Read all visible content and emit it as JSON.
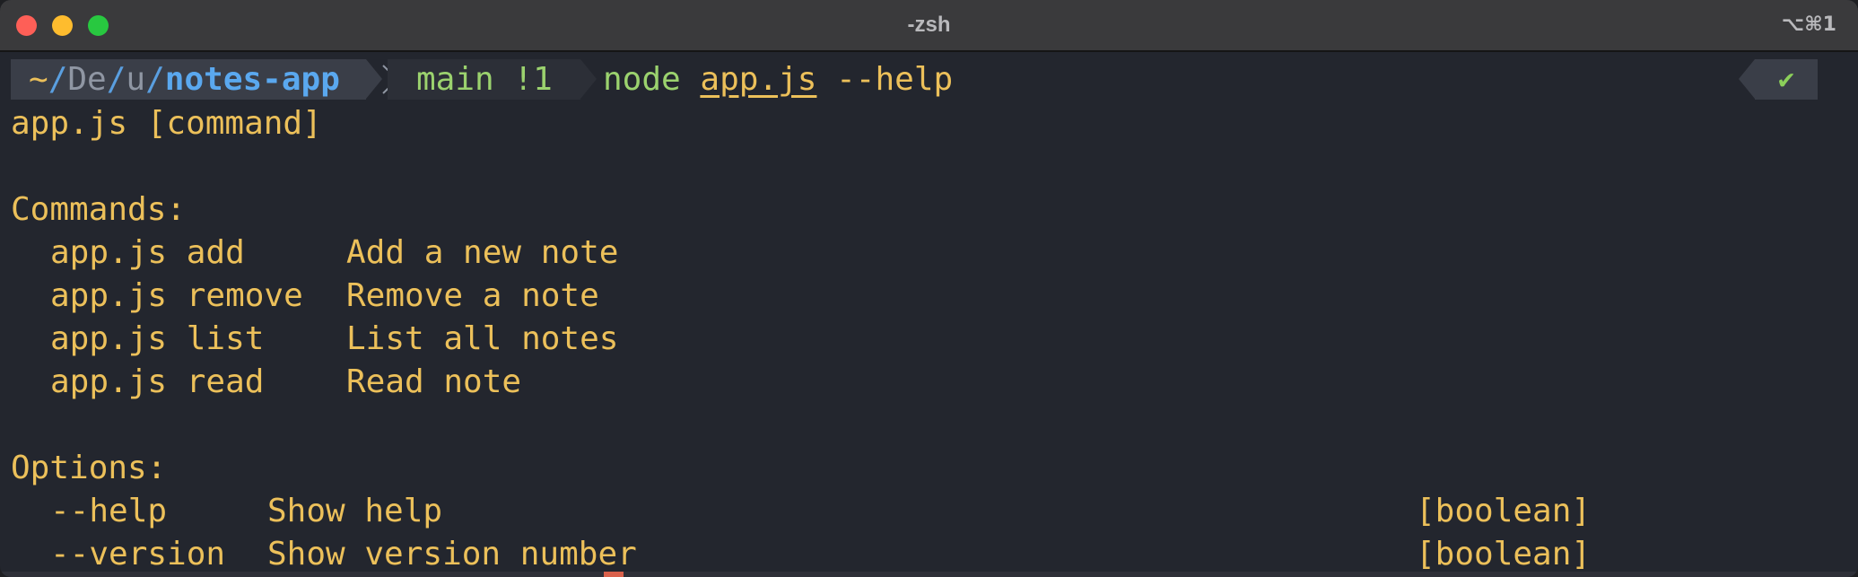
{
  "window": {
    "title": "-zsh",
    "shortcut": "⌥⌘1"
  },
  "prompt": {
    "dir_tilde": "~",
    "dir_parts": [
      "De",
      "u"
    ],
    "dir_current": "notes-app",
    "git_branch": "main",
    "git_status": "!1",
    "command": "node",
    "command_file": "app.js",
    "command_flag": "--help",
    "status_symbol": "✔"
  },
  "output": {
    "usage": "app.js [command]",
    "commands_heading": "Commands:",
    "commands": [
      {
        "cmd": "app.js add",
        "desc": "Add a new note"
      },
      {
        "cmd": "app.js remove",
        "desc": "Remove a note"
      },
      {
        "cmd": "app.js list",
        "desc": "List all notes"
      },
      {
        "cmd": "app.js read",
        "desc": "Read note"
      }
    ],
    "options_heading": "Options:",
    "options": [
      {
        "flag": "--help",
        "desc": "Show help",
        "type": "[boolean]"
      },
      {
        "flag": "--version",
        "desc": "Show version number",
        "type": "[boolean]"
      }
    ]
  },
  "colors": {
    "background": "#23262e",
    "output_text": "#ecc05a",
    "directory_accent": "#5aa8ef",
    "git_text": "#9bd26e",
    "success": "#8bcf5a"
  }
}
